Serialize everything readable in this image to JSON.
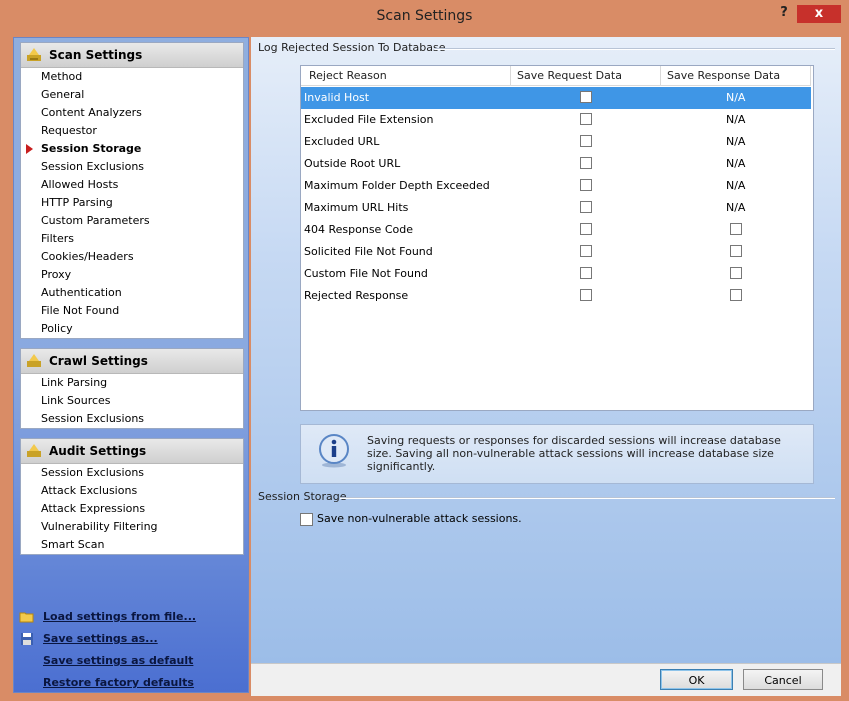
{
  "window": {
    "title": "Scan Settings",
    "help_label": "?",
    "close_label": "x"
  },
  "sidebar": {
    "scan_settings": {
      "title": "Scan Settings",
      "items": [
        "Method",
        "General",
        "Content Analyzers",
        "Requestor",
        "Session Storage",
        "Session Exclusions",
        "Allowed Hosts",
        "HTTP Parsing",
        "Custom Parameters",
        "Filters",
        "Cookies/Headers",
        "Proxy",
        "Authentication",
        "File Not Found",
        "Policy"
      ],
      "active_item": "Session Storage"
    },
    "crawl_settings": {
      "title": "Crawl Settings",
      "items": [
        "Link Parsing",
        "Link Sources",
        "Session Exclusions"
      ]
    },
    "audit_settings": {
      "title": "Audit Settings",
      "items": [
        "Session Exclusions",
        "Attack Exclusions",
        "Attack Expressions",
        "Vulnerability Filtering",
        "Smart Scan"
      ]
    },
    "links": {
      "load": "Load settings from file...",
      "save_as": "Save settings as...",
      "save_default": "Save settings as default",
      "restore": "Restore factory defaults"
    }
  },
  "main": {
    "log_group_label": "Log Rejected Session To Database",
    "table": {
      "headers": [
        "Reject Reason",
        "Save Request Data",
        "Save Response Data"
      ],
      "rows": [
        {
          "reason": "Invalid Host",
          "request_checked": false,
          "response": "N/A",
          "selected": true
        },
        {
          "reason": "Excluded File Extension",
          "request_checked": false,
          "response": "N/A"
        },
        {
          "reason": "Excluded URL",
          "request_checked": false,
          "response": "N/A"
        },
        {
          "reason": "Outside Root URL",
          "request_checked": false,
          "response": "N/A"
        },
        {
          "reason": "Maximum Folder Depth Exceeded",
          "request_checked": false,
          "response": "N/A"
        },
        {
          "reason": "Maximum URL Hits",
          "request_checked": false,
          "response": "N/A"
        },
        {
          "reason": "404 Response Code",
          "request_checked": false,
          "response": "checkbox"
        },
        {
          "reason": "Solicited File Not Found",
          "request_checked": false,
          "response": "checkbox"
        },
        {
          "reason": "Custom File Not Found",
          "request_checked": false,
          "response": "checkbox"
        },
        {
          "reason": "Rejected Response",
          "request_checked": false,
          "response": "checkbox"
        }
      ]
    },
    "info_text": "Saving requests or responses for discarded sessions will increase database size. Saving all non-vulnerable attack sessions will increase database size significantly.",
    "session_storage_label": "Session Storage",
    "save_nonvuln_label": "Save non-vulnerable attack sessions.",
    "save_nonvuln_checked": false
  },
  "footer": {
    "ok_label": "OK",
    "cancel_label": "Cancel"
  },
  "colors": {
    "selection": "#3f96e6",
    "titlebar": "#d98c66",
    "close_button": "#c7302b"
  }
}
